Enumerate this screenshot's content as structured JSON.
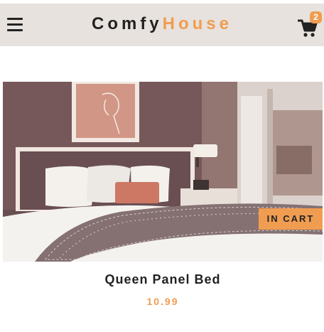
{
  "navbar": {
    "menu_icon": "hamburger-menu-icon",
    "logo_part1": "Comfy",
    "logo_part2": "House",
    "cart_icon": "shopping-cart-icon",
    "cart_count": "2"
  },
  "product": {
    "image": "bedroom-bed-photo",
    "cart_tag": "IN CART",
    "name": "Queen Panel Bed",
    "price": "10.99"
  },
  "colors": {
    "primary": "#f09d51",
    "navbar_bg": "#e7e2dd",
    "text": "#222222"
  }
}
